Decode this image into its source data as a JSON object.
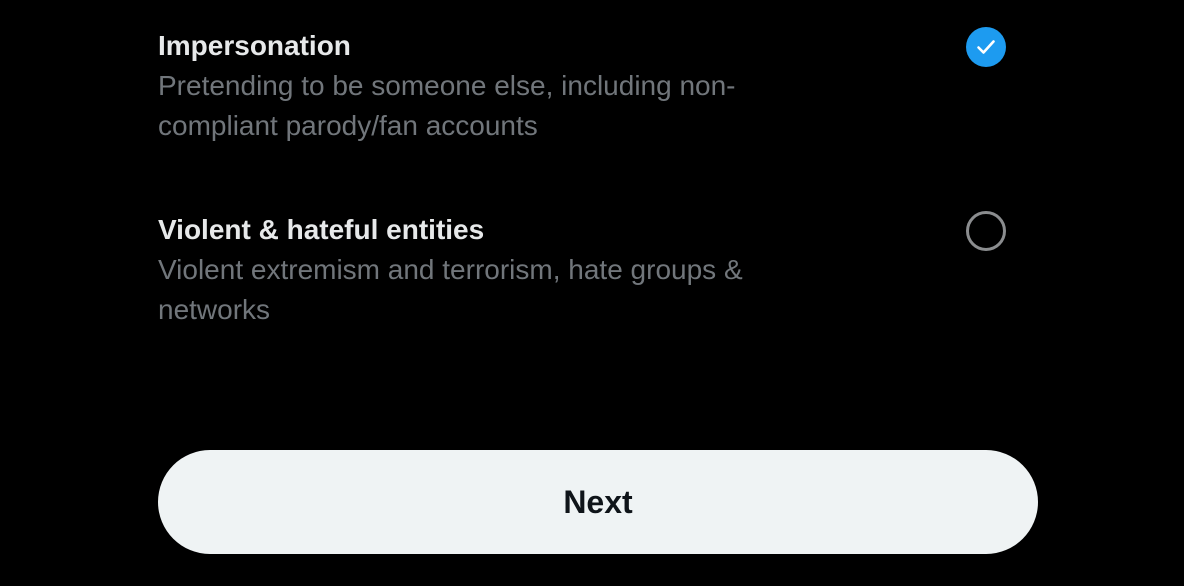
{
  "options": [
    {
      "title": "Impersonation",
      "description": "Pretending to be someone else, including non-compliant parody/fan accounts",
      "selected": true,
      "icon": "check-icon"
    },
    {
      "title": "Violent & hateful entities",
      "description": "Violent extremism and terrorism, hate groups & networks",
      "selected": false,
      "icon": "empty-radio-icon"
    }
  ],
  "next_button": {
    "label": "Next"
  },
  "colors": {
    "background": "#000000",
    "title_text": "#e7e9ea",
    "description_text": "#71767b",
    "accent": "#1d9bf0",
    "button_bg": "#eff3f4",
    "button_text": "#0f1419"
  }
}
